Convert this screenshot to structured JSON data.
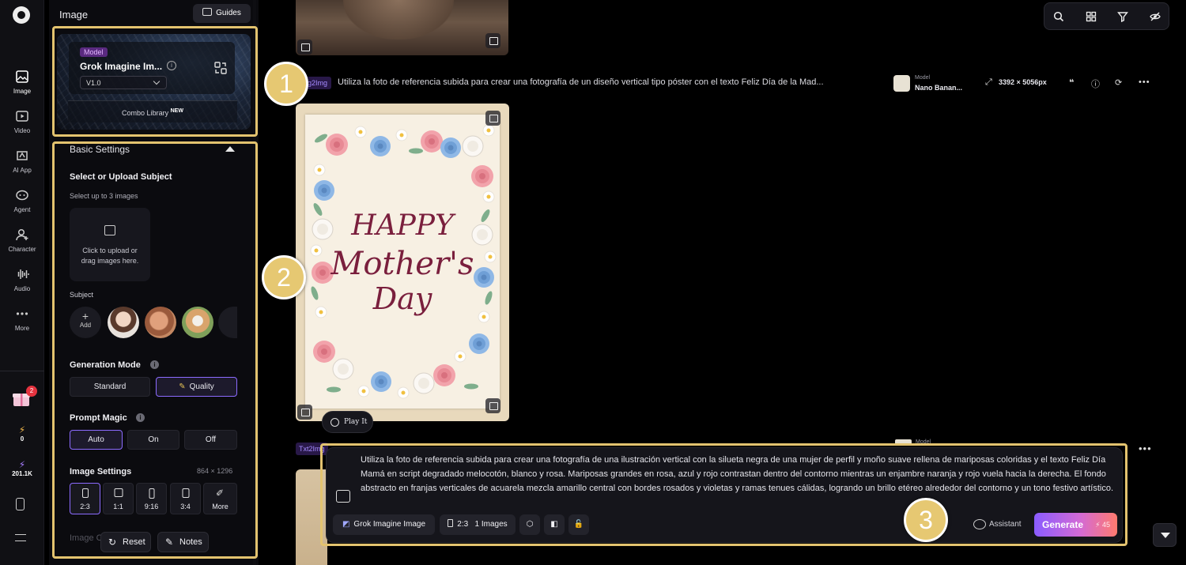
{
  "rail": {
    "items": [
      {
        "label": "Image",
        "icon": "image-icon"
      },
      {
        "label": "Video",
        "icon": "video-icon"
      },
      {
        "label": "AI App",
        "icon": "ai-app-icon"
      },
      {
        "label": "Agent",
        "icon": "agent-icon"
      },
      {
        "label": "Character",
        "icon": "character-icon"
      },
      {
        "label": "Audio",
        "icon": "audio-icon"
      },
      {
        "label": "More",
        "icon": "more-icon"
      }
    ],
    "gift_badge": "2",
    "energy": "0",
    "credits": "201.1K"
  },
  "panel": {
    "title": "Image",
    "guides_label": "Guides",
    "model": {
      "tag": "Model",
      "name": "Grok Imagine Im...",
      "version": "V1.0",
      "combo_label": "Combo Library",
      "combo_badge": "NEW"
    },
    "basic_settings": "Basic Settings",
    "subject_title": "Select or Upload Subject",
    "subject_hint": "Select up to 3 images",
    "upload_line1": "Click to upload or",
    "upload_line2": "drag images here.",
    "subject_label": "Subject",
    "add_label": "Add",
    "generation_mode": {
      "label": "Generation Mode",
      "options": [
        "Standard",
        "Quality"
      ],
      "selected": "Quality"
    },
    "prompt_magic": {
      "label": "Prompt Magic",
      "options": [
        "Auto",
        "On",
        "Off"
      ],
      "selected": "Auto"
    },
    "image_settings": {
      "label": "Image Settings",
      "dimensions": "864 × 1296",
      "ratios": [
        "2:3",
        "1:1",
        "9:16",
        "3:4",
        "More"
      ],
      "selected": "2:3"
    },
    "faded_label": "Image C",
    "reset_label": "Reset",
    "notes_label": "Notes"
  },
  "annotations": [
    "1",
    "2",
    "3"
  ],
  "feed": {
    "row1": {
      "tag": "Img2Img",
      "prompt": "Utiliza la foto de referencia subida para crear una fotografía de un diseño vertical tipo póster con el texto Feliz Día de la Mad...",
      "model_key": "Model",
      "model_value": "Nano Banan...",
      "resolution": "3392 × 5056px"
    },
    "poster": {
      "line1": "HAPPY",
      "line2": "Mother's",
      "line3": "Day",
      "text_color": "#7a1f3d"
    },
    "play_it": "Play It",
    "row2_tag": "Txt2Img",
    "row2_model_key": "Model"
  },
  "composer": {
    "prompt": "Utiliza la foto de referencia subida para crear una fotografía de una ilustración vertical con la silueta negra de una mujer de perfil y moño suave rellena de mariposas coloridas y el texto Feliz Día Mamá en script degradado melocotón, blanco y rosa. Mariposas grandes en rosa, azul y rojo contrastan dentro del contorno mientras un enjambre naranja y rojo vuela hacia la derecha. El fondo abstracto en franjas verticales de acuarela mezcla amarillo central con bordes rosados y violetas y ramas tenues cálidas, logrando un brillo etéreo alrededor del contorno y un tono festivo artístico.",
    "model_chip": "Grok Imagine Image",
    "ratio_chip": "2:3",
    "count_chip": "1 Images",
    "assistant_label": "Assistant",
    "generate_label": "Generate",
    "generate_cost": "45"
  },
  "colors": {
    "accent": "#8c6bff",
    "annotation": "#e3c36f",
    "generate_start": "#8a5cff",
    "generate_end": "#ff7a6e"
  }
}
